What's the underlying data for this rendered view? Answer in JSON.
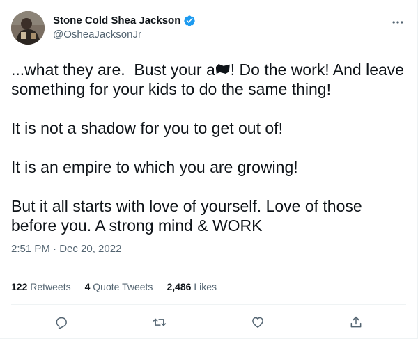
{
  "author": {
    "display_name": "Stone Cold Shea Jackson",
    "handle": "@OsheaJacksonJr",
    "verified_icon": "verified-badge-icon"
  },
  "tweet": {
    "paragraphs": [
      {
        "before": "...what they are.  Bust your a",
        "after": "! Do the work! And leave something for your kids to do the same thing!"
      },
      {
        "text": "It is not a shadow for you to get out of!"
      },
      {
        "text": "It is an empire to which you are growing!"
      },
      {
        "text": "But it all starts with love of yourself. Love of those before you. A strong mind & WORK"
      }
    ],
    "timestamp": "2:51 PM · Dec 20, 2022"
  },
  "stats": {
    "retweets_count": "122",
    "retweets_label": "Retweets",
    "quote_tweets_count": "4",
    "quote_tweets_label": "Quote Tweets",
    "likes_count": "2,486",
    "likes_label": "Likes"
  },
  "actions": {
    "reply_icon": "reply-icon",
    "retweet_icon": "retweet-icon",
    "like_icon": "heart-icon",
    "share_icon": "share-icon"
  },
  "colors": {
    "text_primary": "#0f1419",
    "text_secondary": "#536471",
    "verified_blue": "#1d9bf0",
    "divider": "#eff3f4"
  }
}
